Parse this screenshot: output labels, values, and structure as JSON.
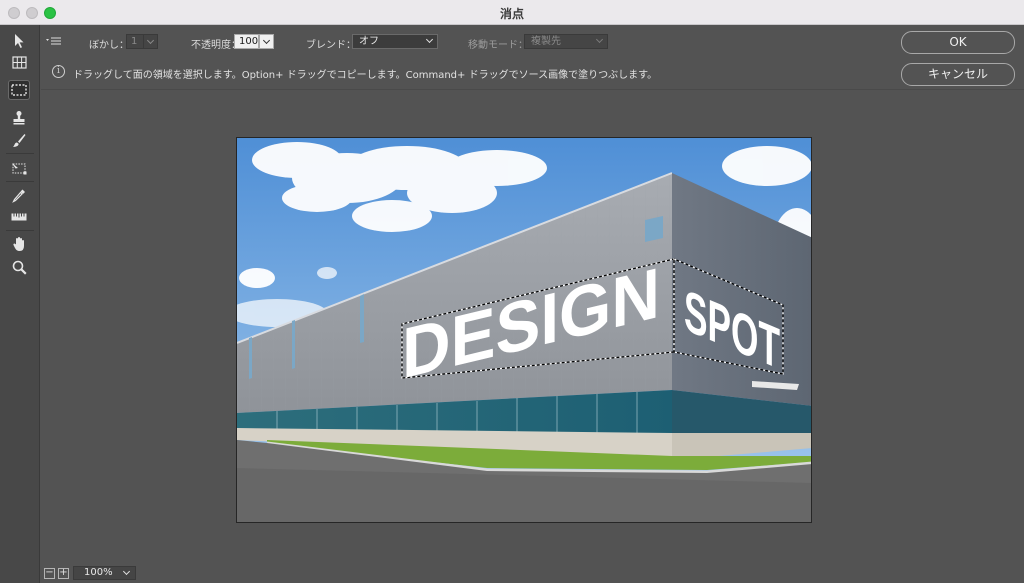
{
  "window": {
    "title": "消点"
  },
  "options": {
    "feather_label": "ぼかし：",
    "feather_value": "1",
    "opacity_label": "不透明度：",
    "opacity_value": "100",
    "blend_label": "ブレンド：",
    "blend_value": "オフ",
    "move_mode_label": "移動モード：",
    "move_mode_value": "複製先",
    "info": "ドラッグして面の領域を選択します。Option+ ドラッグでコピーします。Command+ ドラッグでソース画像で塗りつぶします。"
  },
  "buttons": {
    "ok": "OK",
    "cancel": "キャンセル"
  },
  "tools": [
    {
      "name": "edit-plane-tool-icon",
      "active": false
    },
    {
      "name": "create-plane-tool-icon",
      "active": false
    },
    {
      "name": "marquee-tool-icon",
      "active": true
    },
    {
      "name": "stamp-tool-icon",
      "active": false
    },
    {
      "name": "brush-tool-icon",
      "active": false
    },
    {
      "name": "transform-tool-icon",
      "active": false
    },
    {
      "name": "eyedropper-tool-icon",
      "active": false
    },
    {
      "name": "measure-tool-icon",
      "active": false
    },
    {
      "name": "hand-tool-icon",
      "active": false
    },
    {
      "name": "zoom-tool-icon",
      "active": false
    }
  ],
  "image": {
    "text_left": "DESIGN",
    "text_right": "SPOT"
  },
  "status": {
    "zoom": "100%",
    "zoom_out": "−",
    "zoom_in": "+"
  }
}
